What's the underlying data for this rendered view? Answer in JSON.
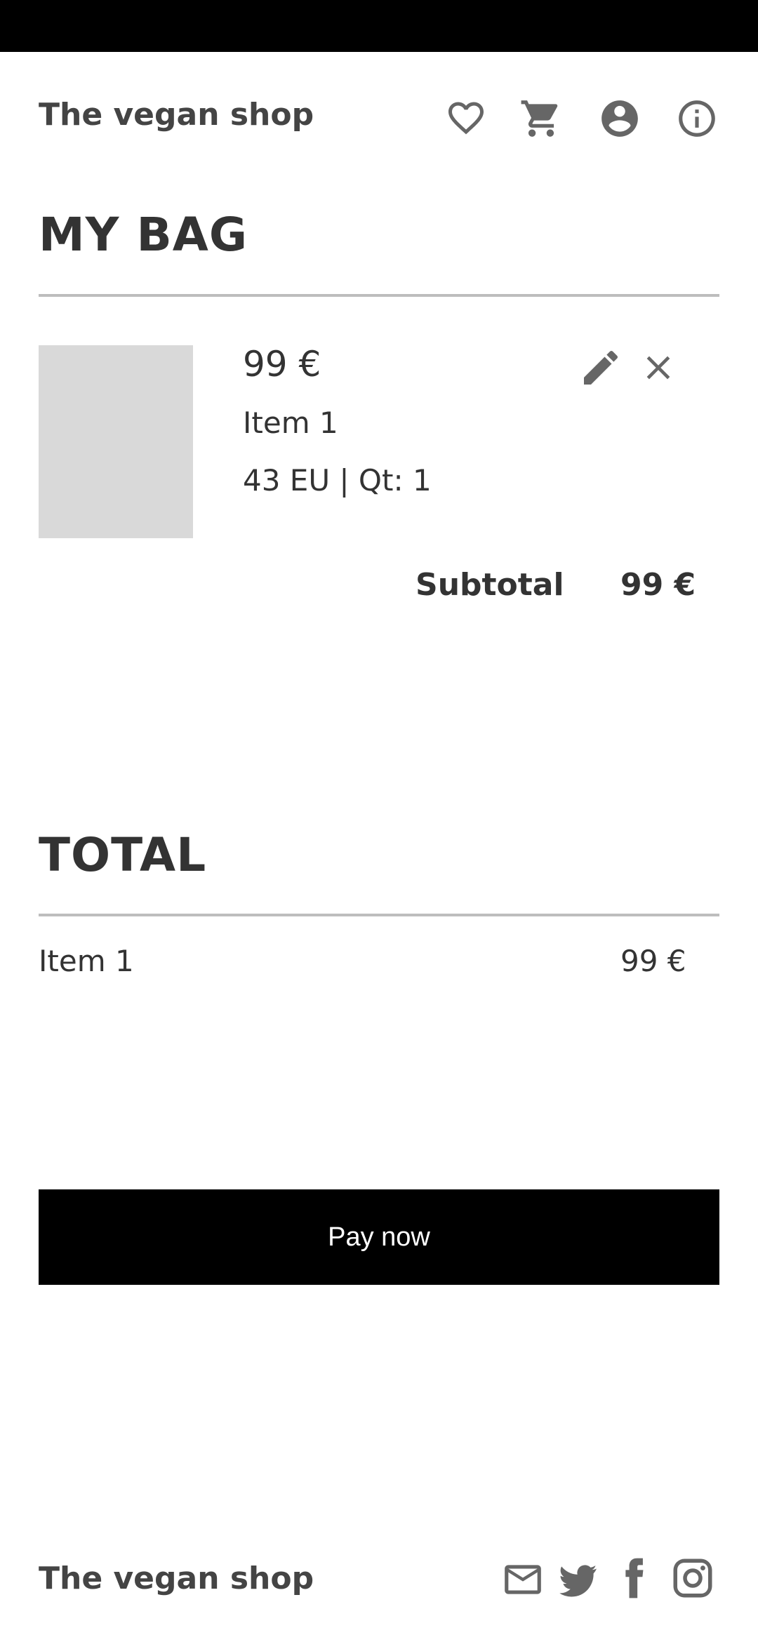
{
  "header": {
    "brand": "The vegan shop",
    "icons": [
      "heart-icon",
      "cart-icon",
      "account-icon",
      "info-icon"
    ]
  },
  "bag": {
    "heading": "MY BAG",
    "items": [
      {
        "price": "99 €",
        "name": "Item 1",
        "details": "43 EU | Qt: 1",
        "actions": [
          "edit-icon",
          "close-icon"
        ]
      }
    ],
    "subtotal_label": "Subtotal",
    "subtotal_value": "99 €"
  },
  "total": {
    "heading": "TOTAL",
    "lines": [
      {
        "name": "Item 1",
        "price": "99 €"
      }
    ]
  },
  "checkout": {
    "pay_label": "Pay now"
  },
  "footer": {
    "brand": "The vegan shop",
    "icons": [
      "mail-icon",
      "twitter-icon",
      "facebook-icon",
      "instagram-icon"
    ]
  },
  "colors": {
    "status_bar": "#000000",
    "text": "#333333",
    "icon": "#666666",
    "divider": "#bdbdbd",
    "placeholder": "#d9d9d9",
    "button": "#000000",
    "button_text": "#ffffff"
  }
}
